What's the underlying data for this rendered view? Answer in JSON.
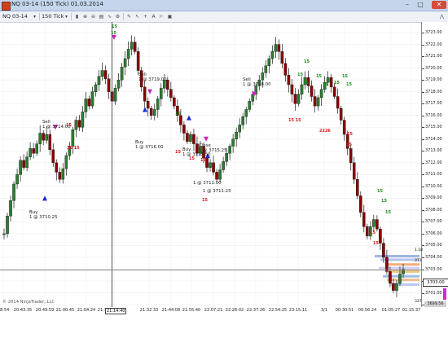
{
  "window": {
    "title": "NQ 03-14 (150 Tick)  01.03.2014",
    "minimize": "–",
    "maximize": "□",
    "close": "✕"
  },
  "toolbar": {
    "instrument": "NQ 03-14",
    "period": "150 Tick",
    "icons": [
      "dropdown-icon",
      "bar-style-icon",
      "zoom-in-icon",
      "zoom-out-icon",
      "properties-icon",
      "indicators-icon",
      "strategies-icon",
      "drawing-tools-icon",
      "pointer-icon",
      "crosshair-icon",
      "text-icon",
      "ruler-icon",
      "snapshot-icon"
    ]
  },
  "chart_data": {
    "type": "candlestick",
    "instrument": "NQ 03-14",
    "period": "150 Tick",
    "date": "01.03.2014",
    "y_ticks": [
      "3723.00",
      "3722.00",
      "3721.00",
      "3720.00",
      "3719.00",
      "3718.00",
      "3717.00",
      "3716.00",
      "3715.00",
      "3714.00",
      "3713.00",
      "3712.00",
      "3711.00",
      "3710.00",
      "3709.00",
      "3708.00",
      "3707.00",
      "3706.00",
      "3705.00",
      "3704.00",
      "3703.00",
      "3702.00",
      "3701.00",
      "3700.00"
    ],
    "ylim": [
      3699.8,
      3723.9
    ],
    "x_ticks": [
      "38:54",
      "20:43:35",
      "20:49:59",
      "21:00:45",
      "21:04:24",
      "21:11:00",
      "21:14:40",
      "21:32:33",
      "21:44:08",
      "21:55:40",
      "22:07:21",
      "22:26:02",
      "22:37:26",
      "22:54:25",
      "23:15:11",
      "3/1",
      "00:30:51",
      "00:56:24",
      "01:05:27",
      "01:15:37"
    ],
    "last_price": "3703.00",
    "close_series": [
      3706.0,
      3707.5,
      3708.8,
      3710.2,
      3711.0,
      3712.2,
      3711.6,
      3712.5,
      3713.2,
      3712.8,
      3713.6,
      3714.5,
      3713.9,
      3714.4,
      3713.1,
      3712.0,
      3711.2,
      3710.6,
      3711.5,
      3712.6,
      3713.4,
      3714.8,
      3715.6,
      3715.0,
      3716.3,
      3717.4,
      3716.8,
      3718.0,
      3718.6,
      3719.3,
      3719.8,
      3719.1,
      3718.0,
      3717.2,
      3718.3,
      3719.0,
      3720.1,
      3720.8,
      3721.6,
      3722.2,
      3721.4,
      3719.8,
      3718.4,
      3717.2,
      3716.6,
      3716.0,
      3716.5,
      3717.4,
      3718.3,
      3719.0,
      3718.2,
      3717.5,
      3716.8,
      3716.0,
      3715.2,
      3714.5,
      3713.8,
      3714.4,
      3713.6,
      3712.8,
      3713.4,
      3712.4,
      3711.6,
      3712.0,
      3711.2,
      3710.6,
      3711.4,
      3712.1,
      3712.8,
      3713.4,
      3714.0,
      3714.6,
      3715.2,
      3715.9,
      3716.5,
      3717.2,
      3717.8,
      3718.5,
      3719.0,
      3719.6,
      3720.2,
      3720.8,
      3721.4,
      3722.0,
      3721.4,
      3720.4,
      3719.4,
      3718.6,
      3717.8,
      3717.0,
      3717.8,
      3718.6,
      3719.2,
      3718.5,
      3717.6,
      3716.8,
      3717.5,
      3718.2,
      3718.8,
      3719.2,
      3718.4,
      3717.6,
      3716.6,
      3715.6,
      3714.4,
      3713.2,
      3712.0,
      3710.6,
      3709.2,
      3707.8,
      3706.6,
      3705.8,
      3706.6,
      3707.2,
      3706.4,
      3705.2,
      3704.0,
      3702.8,
      3701.8,
      3701.2,
      3701.8,
      3702.6,
      3703.0
    ],
    "volume_profile_bars": [
      3704.1,
      3703.8,
      3703.4,
      3703.1,
      3702.8,
      3702.4,
      3702.1,
      3701.7
    ],
    "annotations": [
      {
        "id": "buy-1",
        "lines": [
          "Buy",
          "1 @ 3710.25"
        ]
      },
      {
        "id": "sell-1",
        "lines": [
          "Sell",
          "1 @ 3714.00"
        ]
      },
      {
        "id": "sell-2",
        "lines": [
          "Sell",
          "1 @ 3719.00"
        ]
      },
      {
        "id": "buy-2",
        "lines": [
          "Buy",
          "1 @ 3716.00"
        ]
      },
      {
        "id": "sell-3",
        "lines": [
          "Sell",
          "1 @ 3718.00"
        ]
      },
      {
        "id": "buy-3",
        "lines": [
          "Buy",
          "1 @ 3715.50"
        ]
      },
      {
        "id": "close-1",
        "lines": [
          "Close",
          "1 @ 3715.25"
        ]
      },
      {
        "id": "buy-4",
        "lines": [
          "1 @ 3711.00"
        ]
      },
      {
        "id": "buy-5",
        "lines": [
          "1 @ 3711.25"
        ]
      }
    ],
    "marker_numbers": {
      "green": [
        "15",
        "15",
        "15",
        "15",
        "15",
        "15",
        "15",
        "15",
        "15",
        "15",
        "15",
        "15",
        "15",
        "15"
      ],
      "red": [
        "15",
        "15 15",
        "15 15",
        "2226",
        "15",
        "15",
        "15",
        "15",
        "15",
        "15",
        "15",
        "15"
      ]
    },
    "side_labels": [
      "1.18",
      "372",
      "337"
    ],
    "bottom_price": "3699.56"
  },
  "copyright": "© 2014 NinjaTrader, LLC",
  "crosshair": {
    "price_label": "3703.00",
    "time_label": "21:14:40"
  }
}
